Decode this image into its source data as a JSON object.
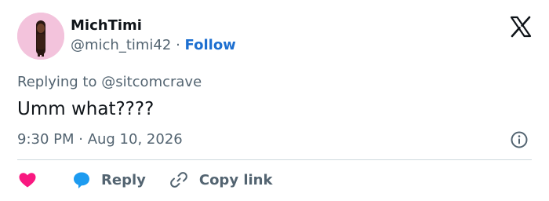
{
  "author": {
    "display_name": "MichTimi",
    "handle": "@mich_timi42",
    "separator": "·",
    "follow_label": "Follow"
  },
  "reply_context": {
    "prefix": "Replying to",
    "mention": "@sitcomcrave"
  },
  "tweet": {
    "text": "Umm what????",
    "timestamp": "9:30 PM · Aug 10, 2026"
  },
  "actions": {
    "reply_label": "Reply",
    "copy_link_label": "Copy link"
  },
  "icons": {
    "brand": "x-logo-icon",
    "like": "heart-icon",
    "reply": "speech-bubble-icon",
    "copy_link": "link-icon",
    "info": "info-icon"
  },
  "colors": {
    "text_primary": "#0f1419",
    "text_secondary": "#536471",
    "link_blue": "#1d6fd0",
    "like_pink": "#f91880",
    "reply_blue": "#1d9bf0",
    "divider": "#cfd9de",
    "avatar_bg": "#f3c3dc"
  }
}
